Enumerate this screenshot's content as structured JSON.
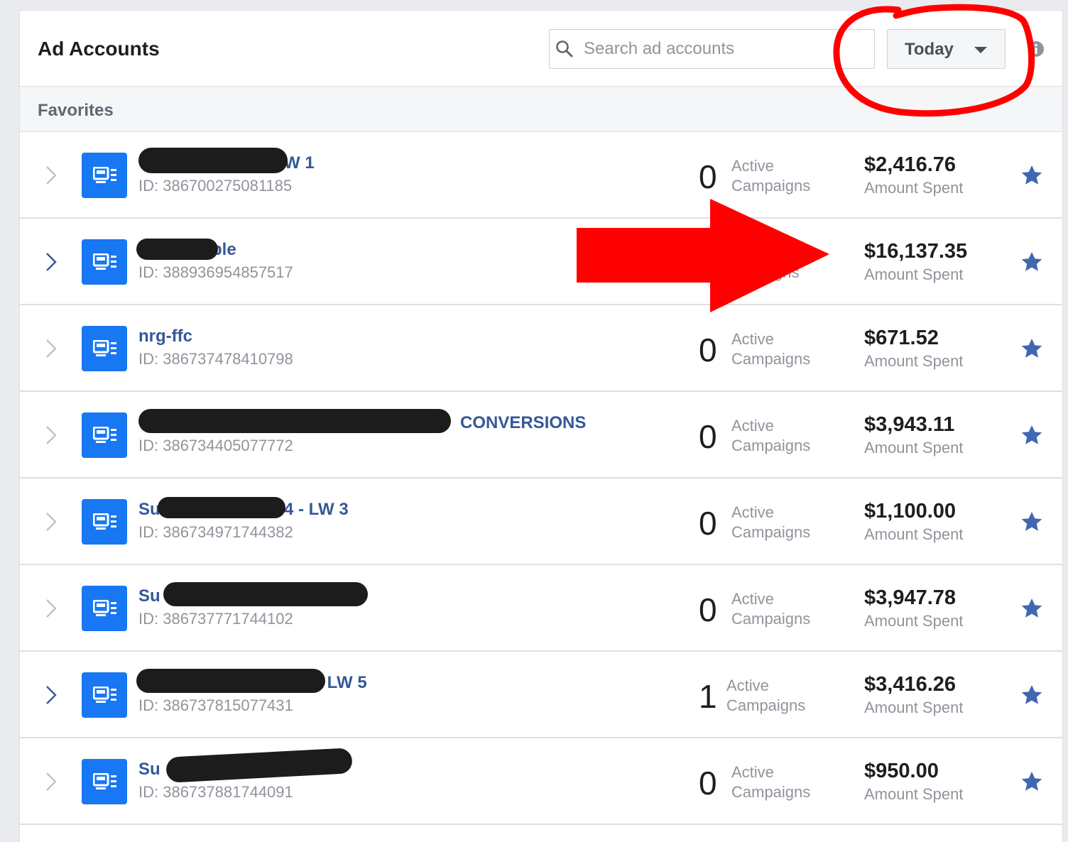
{
  "header": {
    "title": "Ad Accounts",
    "search_placeholder": "Search ad accounts",
    "date_range_label": "Today"
  },
  "section": {
    "label": "Favorites"
  },
  "labels": {
    "active": "Active",
    "campaigns": "Campaigns",
    "amount_spent": "Amount Spent"
  },
  "accounts": [
    {
      "name": "W 1",
      "id": "ID: 386700275081185",
      "active": "0",
      "spent": "$2,416.76"
    },
    {
      "name": "ble",
      "id": "ID: 388936954857517",
      "active": "",
      "spent": "$16,137.35",
      "partial_label": "gns"
    },
    {
      "name": "nrg-ffc",
      "id": "ID: 386737478410798",
      "active": "0",
      "spent": "$671.52"
    },
    {
      "name": "CONVERSIONS",
      "id": "ID: 386734405077772",
      "active": "0",
      "spent": "$3,943.11"
    },
    {
      "name_prefix": "Su",
      "name": "4 - LW 3",
      "id": "ID: 386734971744382",
      "active": "0",
      "spent": "$1,100.00"
    },
    {
      "name_prefix": "Su",
      "name": "",
      "id": "ID: 386737771744102",
      "active": "0",
      "spent": "$3,947.78"
    },
    {
      "name": "- LW 5",
      "id": "ID: 386737815077431",
      "active": "1",
      "spent": "$3,416.26"
    },
    {
      "name_prefix": "Su",
      "name": "",
      "id": "ID: 386737881744091",
      "active": "0",
      "spent": "$950.00"
    }
  ],
  "colors": {
    "accent": "#1877f2",
    "link": "#365899",
    "star": "#4267b2",
    "annotation": "#ff0000"
  },
  "icons": [
    "search-icon",
    "caret-down-icon",
    "info-icon",
    "chevron-right-icon",
    "ad-account-icon",
    "star-icon"
  ]
}
